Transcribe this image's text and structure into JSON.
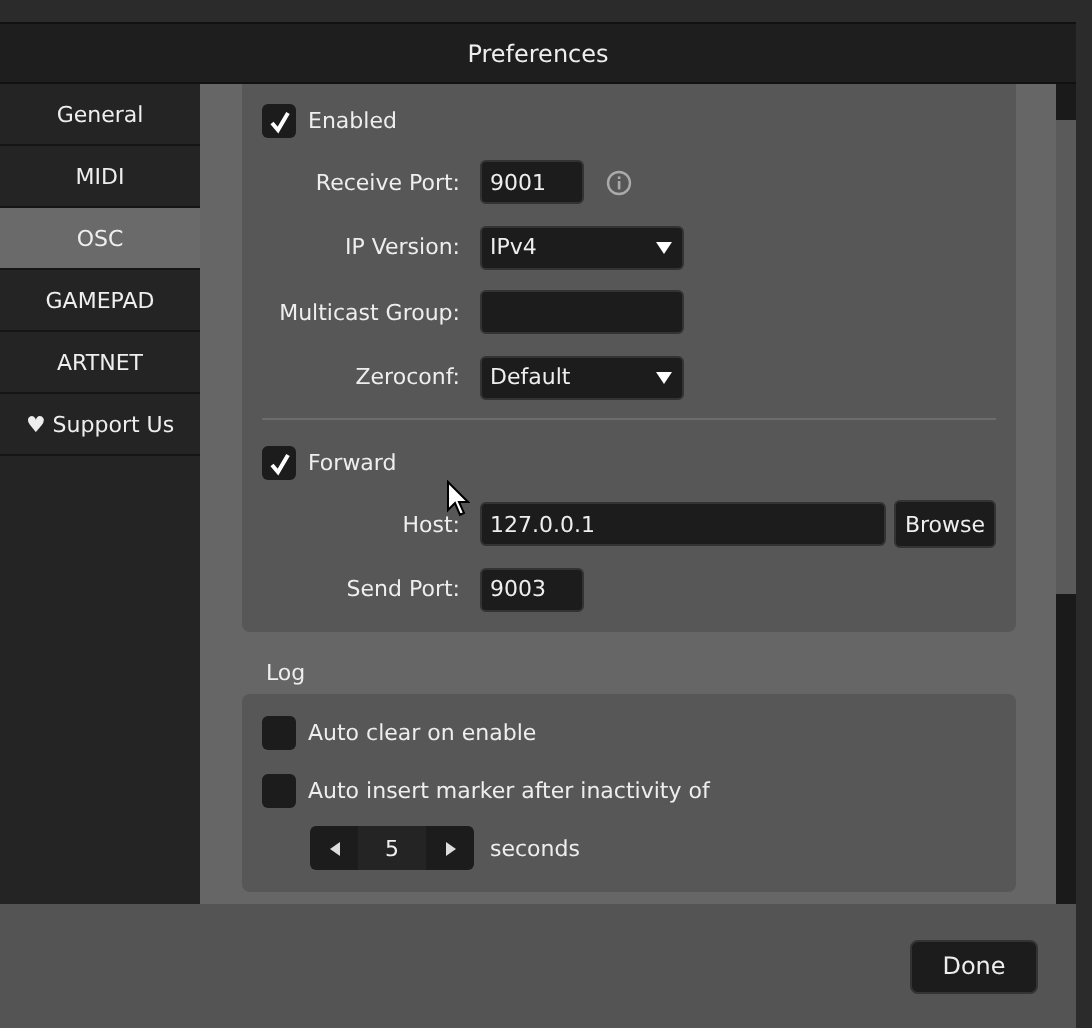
{
  "window": {
    "title": "Preferences"
  },
  "sidebar": {
    "items": [
      {
        "label": "General",
        "selected": false
      },
      {
        "label": "MIDI",
        "selected": false
      },
      {
        "label": "OSC",
        "selected": true
      },
      {
        "label": "GAMEPAD",
        "selected": false
      },
      {
        "label": "ARTNET",
        "selected": false
      },
      {
        "label": "♥ Support Us",
        "selected": false
      }
    ]
  },
  "osc": {
    "rows": [
      {
        "kind": "checkbox",
        "label": "Enabled",
        "checked": true
      },
      {
        "kind": "port_field",
        "label": "Receive Port:",
        "value": "9001",
        "info": true
      },
      {
        "kind": "dropdown",
        "label": "IP Version:",
        "value": "IPv4"
      },
      {
        "kind": "text_field",
        "label": "Multicast Group:"
      },
      {
        "kind": "dropdown",
        "label": "Zeroconf:",
        "value": "Default"
      },
      {
        "kind": "divider"
      },
      {
        "kind": "checkbox",
        "label": "Forward",
        "checked": true
      },
      {
        "kind": "text_field",
        "label": "Host:",
        "value": "127.0.0.1",
        "button": "Browse"
      },
      {
        "kind": "port_field",
        "label": "Send Port:",
        "value": "9003"
      }
    ]
  },
  "log": {
    "title": "Log",
    "rows": [
      {
        "kind": "checkbox",
        "label": "Auto clear on enable",
        "checked": false
      },
      {
        "kind": "checkbox",
        "label": "Auto insert marker after inactivity of",
        "checked": false
      },
      {
        "kind": "spinner",
        "value": "5",
        "unit": "seconds"
      }
    ]
  },
  "buttons": [
    "Done"
  ]
}
